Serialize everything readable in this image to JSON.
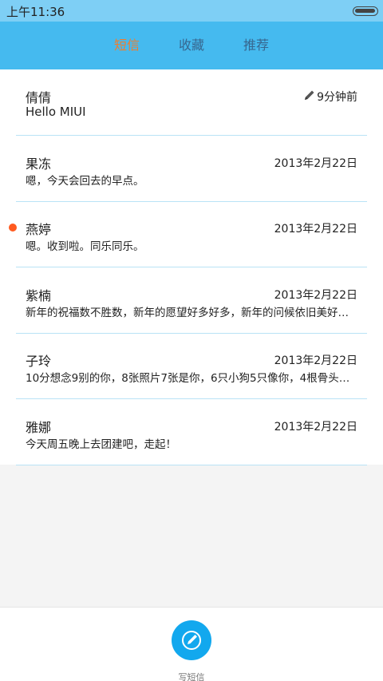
{
  "status_bar": {
    "time": "上午11:36"
  },
  "tabs": [
    {
      "label": "短信",
      "active": true
    },
    {
      "label": "收藏",
      "active": false
    },
    {
      "label": "推荐",
      "active": false
    }
  ],
  "conversations": [
    {
      "name": "倩倩",
      "time": "9分钟前",
      "preview": "Hello MIUI",
      "draft": true,
      "unread": false
    },
    {
      "name": "果冻",
      "time": "2013年2月22日",
      "preview": "嗯，今天会回去的早点。",
      "draft": false,
      "unread": false
    },
    {
      "name": "燕婷",
      "time": "2013年2月22日",
      "preview": "嗯。收到啦。同乐同乐。",
      "draft": false,
      "unread": true
    },
    {
      "name": "紫楠",
      "time": "2013年2月22日",
      "preview": "新年的祝福数不胜数，新年的愿望好多好多，新年的问候依旧美好…",
      "draft": false,
      "unread": false
    },
    {
      "name": "子玲",
      "time": "2013年2月22日",
      "preview": "10分想念9别的你，8张照片7张是你，6只小狗5只像你，4根骨头…",
      "draft": false,
      "unread": false
    },
    {
      "name": "雅娜",
      "time": "2013年2月22日",
      "preview": "今天周五晚上去团建吧，走起！",
      "draft": false,
      "unread": false
    }
  ],
  "compose": {
    "label": "写短信"
  },
  "colors": {
    "header": "#45baef",
    "active_tab": "#f07d2c",
    "unread_dot": "#ff5a1f",
    "compose_button": "#12a8ee"
  },
  "icons": {
    "draft": "pencil-icon",
    "compose": "compose-icon",
    "battery": "battery-icon"
  }
}
